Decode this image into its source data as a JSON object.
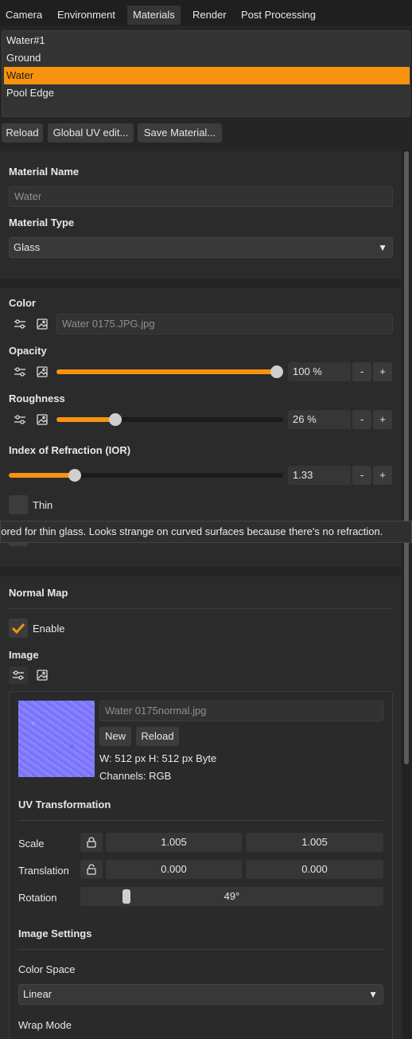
{
  "tabs": [
    "Camera",
    "Environment",
    "Materials",
    "Render",
    "Post Processing"
  ],
  "active_tab": "Materials",
  "materials": [
    "Water#1",
    "Ground",
    "Water",
    "Pool Edge"
  ],
  "selected_material": "Water",
  "toolbar": {
    "reload": "Reload",
    "global_uv": "Global UV edit...",
    "save": "Save Material..."
  },
  "material": {
    "name_label": "Material Name",
    "name_value": "Water",
    "type_label": "Material Type",
    "type_value": "Glass"
  },
  "color": {
    "label": "Color",
    "texture": "Water 0175.JPG.jpg"
  },
  "opacity": {
    "label": "Opacity",
    "display": "100 %",
    "value": 1.0
  },
  "roughness": {
    "label": "Roughness",
    "display": "26 %",
    "value": 0.26
  },
  "ior": {
    "label": "Index of Refraction (IOR)",
    "display": "1.33",
    "value": 0.24
  },
  "thin": {
    "label": "Thin",
    "checked": false
  },
  "tooltip": "nored for thin glass. Looks strange on curved surfaces because there's no refraction.",
  "stepper": {
    "minus": "-",
    "plus": "+"
  },
  "normal_map": {
    "title": "Normal Map",
    "enable_label": "Enable",
    "enabled": true,
    "image_label": "Image",
    "file": "Water 0175normal.jpg",
    "new_button": "New",
    "reload_button": "Reload",
    "dims": "W: 512 px H: 512 px Byte",
    "channels": "Channels: RGB",
    "uv_title": "UV Transformation",
    "scale_label": "Scale",
    "scale_u": "1.005",
    "scale_v": "1.005",
    "translation_label": "Translation",
    "trans_u": "0.000",
    "trans_v": "0.000",
    "rotation_label": "Rotation",
    "rotation_value": "49°",
    "rotation_fraction": 0.14,
    "image_settings_title": "Image Settings",
    "color_space_label": "Color Space",
    "color_space_value": "Linear",
    "wrap_mode_label": "Wrap Mode"
  },
  "colors": {
    "accent": "#f7930f",
    "background": "#252525",
    "panel": "#2b2b2b"
  }
}
